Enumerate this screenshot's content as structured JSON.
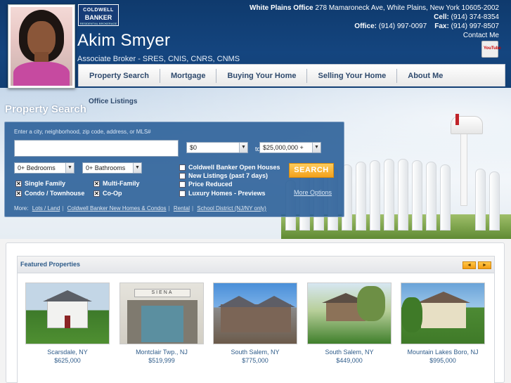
{
  "header": {
    "logo_line1": "COLDWELL",
    "logo_line2": "BANKER",
    "logo_line3": "RESIDENTIAL BROKERAGE",
    "agent_name": "Akim Smyer",
    "agent_title": "Associate Broker - SRES, CNIS, CNRS, CNMS",
    "contact": {
      "office_label": "White Plains Office",
      "office_address": "278 Mamaroneck Ave, White Plains, New York 10605-2002",
      "cell_label": "Cell:",
      "cell_value": "(914) 374-8354",
      "office_phone_label": "Office:",
      "office_phone_value": "(914) 997-0097",
      "fax_label": "Fax:",
      "fax_value": "(914) 997-8507",
      "contact_me": "Contact Me"
    },
    "youtube_label": "YouTube"
  },
  "nav": {
    "items": [
      "Property Search",
      "Mortgage",
      "Buying Your Home",
      "Selling Your Home",
      "About Me"
    ]
  },
  "hero": {
    "office_listings": "Office Listings",
    "title": "Property Search",
    "search_hint": "Enter a city, neighborhood, zip code, address, or MLS#",
    "search_value": "",
    "price_min": "$0",
    "price_to": "to",
    "price_max": "$25,000,000 +",
    "bedrooms": "0+ Bedrooms",
    "bathrooms": "0+ Bathrooms",
    "property_types": [
      {
        "label": "Single Family",
        "checked": true
      },
      {
        "label": "Multi-Family",
        "checked": true
      },
      {
        "label": "Condo / Townhouse",
        "checked": true
      },
      {
        "label": "Co-Op",
        "checked": true
      }
    ],
    "filters": [
      {
        "label": "Coldwell Banker Open Houses",
        "checked": false
      },
      {
        "label": "New Listings (past 7 days)",
        "checked": false
      },
      {
        "label": "Price Reduced",
        "checked": false
      },
      {
        "label": "Luxury Homes - Previews",
        "checked": false
      }
    ],
    "search_button": "SEARCH",
    "more_options": "More Options",
    "more_label": "More:",
    "more_links": [
      "Lots / Land",
      "Coldwell Banker New Homes & Condos",
      "Rental",
      "School District (NJ/NY only)"
    ]
  },
  "featured": {
    "title": "Featured Properties",
    "prev": "◄",
    "next": "►",
    "properties": [
      {
        "location": "Scarsdale, NY",
        "price": "$625,000"
      },
      {
        "location": "Montclair Twp., NJ",
        "price": "$519,999"
      },
      {
        "location": "South Salem, NY",
        "price": "$775,000"
      },
      {
        "location": "South Salem, NY",
        "price": "$449,000"
      },
      {
        "location": "Mountain Lakes Boro, NJ",
        "price": "$995,000"
      }
    ]
  }
}
